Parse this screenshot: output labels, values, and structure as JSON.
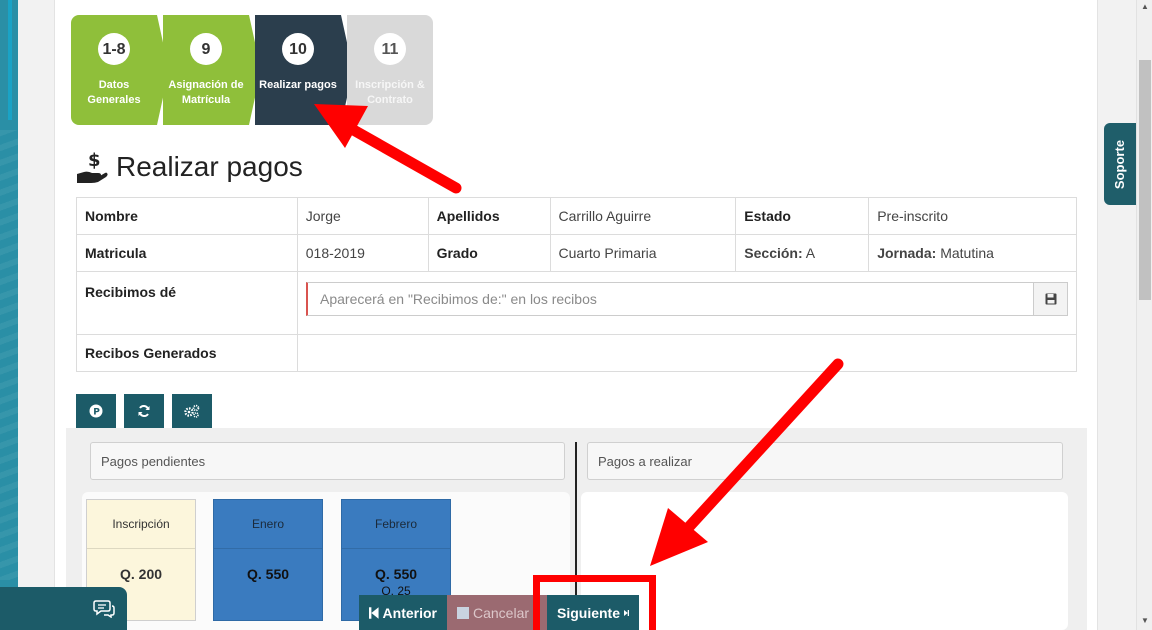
{
  "stepper": {
    "steps": [
      {
        "num": "1-8",
        "label": "Datos Generales"
      },
      {
        "num": "9",
        "label": "Asignación de Matrícula"
      },
      {
        "num": "10",
        "label": "Realizar pagos"
      },
      {
        "num": "11",
        "label": "Inscripción & Contrato"
      }
    ]
  },
  "page": {
    "title": "Realizar pagos"
  },
  "info": {
    "nombre_label": "Nombre",
    "nombre": "Jorge",
    "apellidos_label": "Apellidos",
    "apellidos": "Carrillo Aguirre",
    "estado_label": "Estado",
    "estado": "Pre-inscrito",
    "matricula_label": "Matricula",
    "matricula": "018-2019",
    "grado_label": "Grado",
    "grado": "Cuarto Primaria",
    "seccion_label": "Sección:",
    "seccion": "A",
    "jornada_label": "Jornada:",
    "jornada": "Matutina",
    "recibimos_label": "Recibimos dé",
    "recibimos_placeholder": "Aparecerá en \"Recibimos de:\" en los recibos",
    "recibos_label": "Recibos Generados"
  },
  "panels": {
    "pending_title": "Pagos pendientes",
    "to_pay_title": "Pagos a realizar"
  },
  "payments": [
    {
      "title": "Inscripción",
      "amount": "Q. 200",
      "sub": ""
    },
    {
      "title": "Enero",
      "amount": "Q. 550",
      "sub": ""
    },
    {
      "title": "Febrero",
      "amount": "Q. 550",
      "sub": "Q. 25"
    }
  ],
  "nav": {
    "prev": "Anterior",
    "cancel": "Cancelar",
    "next": "Siguiente"
  },
  "support": {
    "label": "Soporte"
  },
  "colors": {
    "teal": "#1c5b68",
    "green_step": "#8fbf3a",
    "dark_step": "#2b3e4d",
    "annotation": "#ff0000"
  }
}
